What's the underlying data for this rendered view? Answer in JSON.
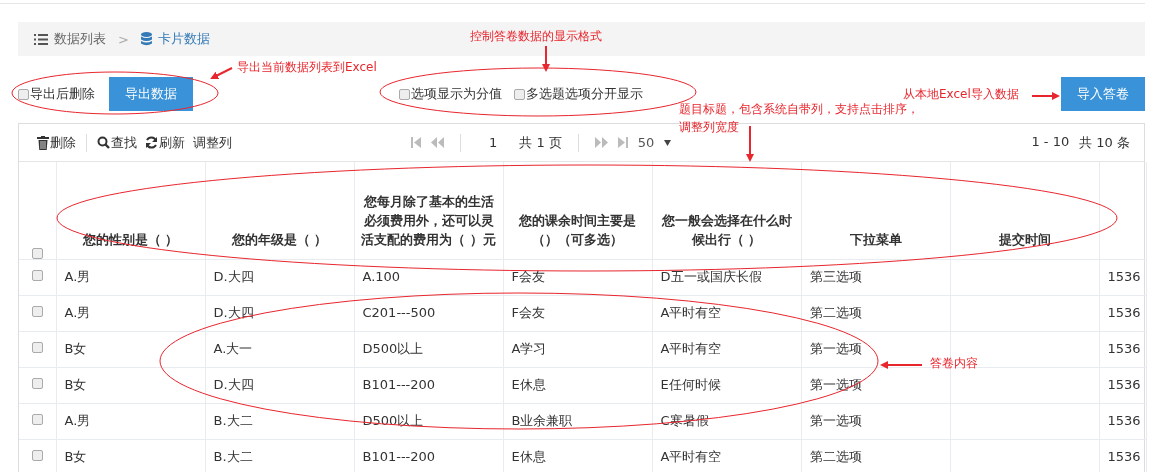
{
  "breadcrumb": {
    "items": [
      {
        "label": "数据列表",
        "current": false
      },
      {
        "label": "卡片数据",
        "current": true
      }
    ],
    "separator": ">"
  },
  "export": {
    "delete_after": {
      "label": "导出后删除",
      "checked": false
    },
    "button": "导出数据"
  },
  "display_options": [
    {
      "label": "选项显示为分值",
      "checked": false
    },
    {
      "label": "多选题选项分开显示",
      "checked": false
    }
  ],
  "import_button": "导入答卷",
  "toolbar": [
    {
      "label": "删除",
      "kind": "trash"
    },
    {
      "label": "查找",
      "kind": "search"
    },
    {
      "label": "刷新",
      "kind": "refresh"
    },
    {
      "label": "调整列",
      "kind": "text"
    }
  ],
  "pagination": {
    "page": "1",
    "total_pages": "共 1 页",
    "page_size": "50",
    "range": "1 - 10",
    "total": "共 10 条"
  },
  "table": {
    "select_all_checked": false,
    "columns": [
      "您的性别是（   ）",
      "您的年级是（   ）",
      "您每月除了基本的生活必须费用外，还可以灵活支配的费用为（   ）元",
      "您的课余时间主要是（）（可多选）",
      "您一般会选择在什么时候出行（   ）",
      "下拉菜单",
      "提交时间"
    ],
    "rows": [
      {
        "selected": false,
        "cells": [
          "A.男",
          "D.大四",
          "A.100",
          "F会友",
          "D五一或国庆长假",
          "第三选项"
        ],
        "column_9": "1536"
      },
      {
        "selected": false,
        "cells": [
          "A.男",
          "D.大四",
          "C201---500",
          "F会友",
          "A平时有空",
          "第二选项"
        ],
        "column_9": "1536"
      },
      {
        "selected": false,
        "cells": [
          "B女",
          "A.大一",
          "D500以上",
          "A学习",
          "A平时有空",
          "第一选项"
        ],
        "column_9": "1536"
      },
      {
        "selected": false,
        "cells": [
          "B女",
          "D.大四",
          "B101---200",
          "E休息",
          "E任何时候",
          "第一选项"
        ],
        "column_9": "1536"
      },
      {
        "selected": false,
        "cells": [
          "A.男",
          "B.大二",
          "D500以上",
          "B业余兼职",
          "C寒暑假",
          "第一选项"
        ],
        "column_9": "1536"
      },
      {
        "selected": false,
        "cells": [
          "B女",
          "B.大二",
          "B101---200",
          "E休息",
          "A平时有空",
          "第二选项"
        ],
        "column_9": "1536"
      }
    ]
  },
  "annotations": [
    {
      "text": "控制答卷数据的显示格式"
    },
    {
      "text": "导出当前数据列表到Excel"
    },
    {
      "text": "从本地Excel导入数据"
    },
    {
      "text": "题目标题，包含系统自带列，支持点击排序，"
    },
    {
      "text": "调整列宽度"
    },
    {
      "text": "答卷内容"
    }
  ]
}
